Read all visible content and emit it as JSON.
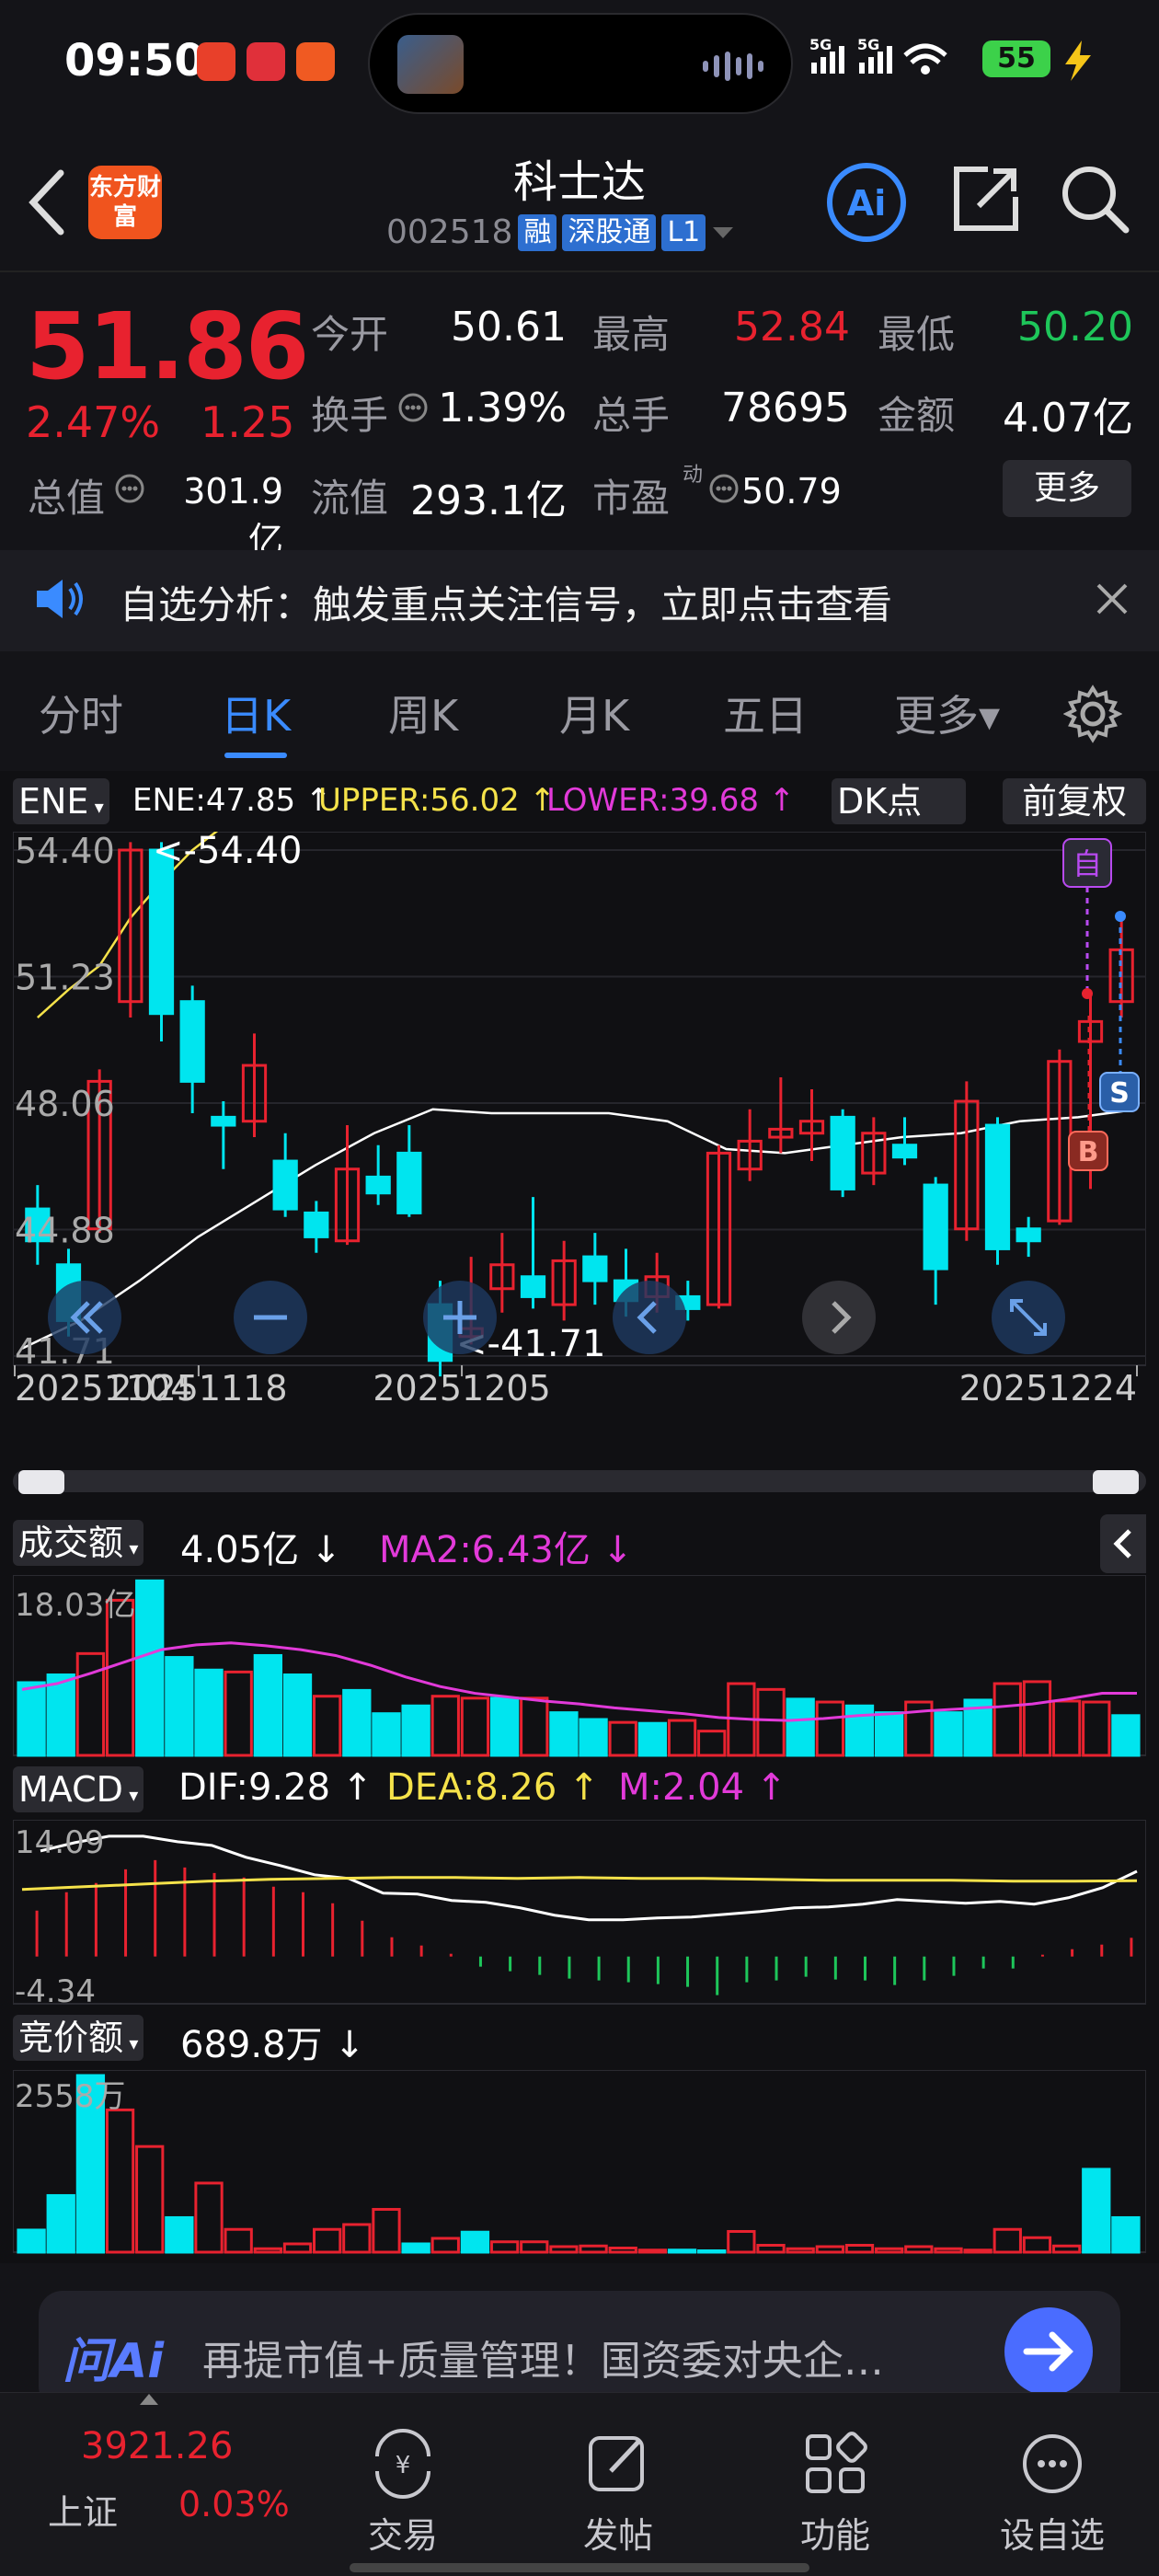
{
  "status_bar": {
    "time": "09:50",
    "battery": "55",
    "network": "5G 5G"
  },
  "header": {
    "logo_text": "东方财富",
    "stock_name": "科士达",
    "stock_code": "002518",
    "tags": [
      "融",
      "深股通",
      "L1"
    ]
  },
  "quote": {
    "price": "51.86",
    "change_pct": "2.47%",
    "change_amt": "1.25",
    "open_label": "今开",
    "open": "50.61",
    "high_label": "最高",
    "high": "52.84",
    "low_label": "最低",
    "low": "50.20",
    "turnover_label": "换手",
    "turnover": "1.39%",
    "volume_label": "总手",
    "volume": "78695",
    "amount_label": "金额",
    "amount": "4.07亿",
    "mktcap_label": "总值",
    "mktcap": "301.9亿",
    "float_label": "流值",
    "float": "293.1亿",
    "pe_label": "市盈",
    "pe_sup": "动",
    "pe": "50.79",
    "more": "更多"
  },
  "notice": {
    "text": "自选分析：触发重点关注信号，立即点击查看"
  },
  "tabs": [
    "分时",
    "日K",
    "周K",
    "月K",
    "五日",
    "更多▾"
  ],
  "kline": {
    "indicator": "ENE",
    "ene": "ENE:47.85 ↑",
    "upper": "UPPER:56.02 ↑",
    "lower": "LOWER:39.68 ↑",
    "dk_button": "DK点",
    "adjust_button": "前复权",
    "y_labels": [
      "54.40",
      "51.23",
      "48.06",
      "44.88",
      "41.71"
    ],
    "max_marker": "<-54.40",
    "min_marker": "<-41.71",
    "x_labels": [
      "20251104",
      "20251118",
      "20251205",
      "20251224"
    ],
    "mark_self": "自",
    "mark_s": "S",
    "mark_b": "B"
  },
  "volume_panel": {
    "indicator": "成交额",
    "value": "4.05亿 ↓",
    "ma2": "MA2:6.43亿 ↓",
    "y_max": "18.03亿"
  },
  "macd_panel": {
    "indicator": "MACD",
    "dif": "DIF:9.28 ↑",
    "dea": "DEA:8.26 ↑",
    "m": "M:2.04 ↑",
    "y_max": "14.09",
    "y_min": "-4.34"
  },
  "auction_panel": {
    "indicator": "竞价额",
    "value": "689.8万 ↓",
    "y_max": "2558万"
  },
  "ai_bar": {
    "logo": "问Ai",
    "text": "再提市值+质量管理！国资委对央企…"
  },
  "index": {
    "value": "3921.26",
    "name": "上证",
    "pct": "0.03%"
  },
  "nav": [
    "交易",
    "发帖",
    "功能",
    "设自选"
  ],
  "colors": {
    "up": "#e8222f",
    "down": "#1ec65a",
    "cyan": "#00e5ef",
    "accent": "#3a8bff",
    "yellow": "#f5e24a",
    "magenta": "#e23ad9"
  },
  "chart_data": [
    {
      "type": "candlestick",
      "title": "日K",
      "ylim": [
        41.71,
        54.4
      ],
      "candles": [
        {
          "o": 45.4,
          "c": 44.6,
          "h": 46.0,
          "l": 44.0
        },
        {
          "o": 44.0,
          "c": 42.6,
          "h": 44.4,
          "l": 42.2
        },
        {
          "o": 44.9,
          "c": 48.6,
          "h": 48.9,
          "l": 44.8
        },
        {
          "o": 50.6,
          "c": 54.4,
          "h": 54.6,
          "l": 50.2
        },
        {
          "o": 54.4,
          "c": 50.3,
          "h": 54.6,
          "l": 49.6
        },
        {
          "o": 50.6,
          "c": 48.6,
          "h": 51.0,
          "l": 47.8
        },
        {
          "o": 47.7,
          "c": 47.5,
          "h": 48.1,
          "l": 46.4
        },
        {
          "o": 47.6,
          "c": 49.0,
          "h": 49.8,
          "l": 47.2
        },
        {
          "o": 46.6,
          "c": 45.4,
          "h": 47.3,
          "l": 45.2
        },
        {
          "o": 45.3,
          "c": 44.7,
          "h": 45.6,
          "l": 44.3
        },
        {
          "o": 44.6,
          "c": 46.4,
          "h": 47.5,
          "l": 44.5
        },
        {
          "o": 46.2,
          "c": 45.8,
          "h": 47.0,
          "l": 45.5
        },
        {
          "o": 46.8,
          "c": 45.3,
          "h": 47.5,
          "l": 45.2
        },
        {
          "o": 43.0,
          "c": 41.6,
          "h": 43.6,
          "l": 41.2
        },
        {
          "o": 42.2,
          "c": 42.4,
          "h": 44.2,
          "l": 42.0
        },
        {
          "o": 43.4,
          "c": 44.0,
          "h": 44.8,
          "l": 42.8
        },
        {
          "o": 43.7,
          "c": 43.2,
          "h": 45.7,
          "l": 42.9
        },
        {
          "o": 43.0,
          "c": 44.1,
          "h": 44.6,
          "l": 42.6
        },
        {
          "o": 44.2,
          "c": 43.6,
          "h": 44.8,
          "l": 43.0
        },
        {
          "o": 43.6,
          "c": 43.1,
          "h": 44.4,
          "l": 42.7
        },
        {
          "o": 43.2,
          "c": 43.7,
          "h": 44.3,
          "l": 42.8
        },
        {
          "o": 43.2,
          "c": 42.9,
          "h": 43.6,
          "l": 42.6
        },
        {
          "o": 43.0,
          "c": 46.8,
          "h": 47.0,
          "l": 42.9
        },
        {
          "o": 46.4,
          "c": 47.1,
          "h": 47.9,
          "l": 46.1
        },
        {
          "o": 47.2,
          "c": 47.4,
          "h": 48.7,
          "l": 46.8
        },
        {
          "o": 47.3,
          "c": 47.6,
          "h": 48.4,
          "l": 46.6
        },
        {
          "o": 47.7,
          "c": 45.9,
          "h": 47.9,
          "l": 45.7
        },
        {
          "o": 46.3,
          "c": 47.3,
          "h": 47.7,
          "l": 46.0
        },
        {
          "o": 47.0,
          "c": 46.7,
          "h": 47.7,
          "l": 46.5
        },
        {
          "o": 46.0,
          "c": 43.9,
          "h": 46.2,
          "l": 43.0
        },
        {
          "o": 44.9,
          "c": 48.1,
          "h": 48.6,
          "l": 44.6
        },
        {
          "o": 47.5,
          "c": 44.4,
          "h": 47.7,
          "l": 44.0
        },
        {
          "o": 44.9,
          "c": 44.6,
          "h": 45.2,
          "l": 44.2
        },
        {
          "o": 45.1,
          "c": 49.1,
          "h": 49.4,
          "l": 45.0
        },
        {
          "o": 49.6,
          "c": 50.1,
          "h": 50.8,
          "l": 45.9
        },
        {
          "o": 50.6,
          "c": 51.9,
          "h": 52.8,
          "l": 50.2
        }
      ],
      "ene_upper": [
        50.2,
        50.9,
        51.5,
        52.7,
        53.6,
        54.4,
        55.0,
        55.7,
        56.0,
        56.0
      ],
      "ene_mid": [
        41.9,
        42.6,
        43.6,
        44.7,
        45.6,
        46.5,
        47.3,
        47.9,
        47.8,
        47.8,
        47.8,
        47.6,
        46.9,
        46.8,
        47.0,
        47.2,
        47.3,
        47.6,
        47.7,
        47.9
      ]
    },
    {
      "type": "bar",
      "title": "成交额",
      "y_max_label": "18.03亿",
      "values": [
        7.5,
        8.3,
        10.5,
        16.0,
        18.0,
        10.1,
        8.8,
        8.6,
        10.3,
        8.3,
        6.1,
        6.7,
        4.3,
        5.1,
        6.1,
        5.9,
        5.9,
        5.9,
        4.4,
        3.7,
        3.4,
        3.3,
        3.6,
        2.5,
        7.4,
        6.8,
        5.8,
        5.5,
        5.1,
        4.4,
        5.5,
        4.4,
        5.7,
        7.4,
        7.6,
        5.6,
        5.5,
        4.1
      ],
      "up": [
        false,
        false,
        true,
        true,
        false,
        false,
        false,
        true,
        false,
        false,
        true,
        false,
        false,
        false,
        true,
        true,
        false,
        true,
        false,
        false,
        true,
        false,
        true,
        true,
        true,
        true,
        false,
        true,
        false,
        false,
        true,
        false,
        false,
        true,
        true,
        true,
        true,
        false
      ],
      "ma2": [
        6.8,
        7.4,
        8.5,
        9.7,
        10.9,
        11.4,
        11.6,
        11.3,
        10.9,
        10.3,
        9.3,
        8.1,
        7.1,
        6.4,
        6.0,
        5.6,
        5.3,
        4.9,
        4.6,
        4.3,
        3.9,
        3.7,
        3.6,
        3.8,
        4.1,
        4.3,
        4.6,
        4.8,
        5.0,
        5.3,
        5.8,
        6.4,
        6.4
      ]
    },
    {
      "type": "bar",
      "title": "MACD",
      "ylim": [
        -4.34,
        14.09
      ],
      "values": [
        5.0,
        7.0,
        8.0,
        9.5,
        10.5,
        9.7,
        9.1,
        8.6,
        7.6,
        7.0,
        5.8,
        3.9,
        2.1,
        1.2,
        0.3,
        -1.1,
        -1.6,
        -2.0,
        -2.4,
        -2.6,
        -2.8,
        -3.0,
        -3.3,
        -4.2,
        -2.8,
        -2.6,
        -2.2,
        -2.5,
        -2.6,
        -3.1,
        -2.6,
        -2.1,
        -1.3,
        -1.3,
        0.2,
        0.8,
        1.3,
        2.04
      ],
      "dif_series": [
        11.5,
        12.4,
        13.1,
        13.1,
        12.5,
        12.1,
        10.8,
        9.9,
        8.9,
        8.5,
        6.9,
        6.8,
        6.1,
        5.9,
        5.3,
        4.5,
        4.0,
        4.0,
        4.2,
        4.3,
        4.6,
        4.9,
        5.3,
        5.4,
        5.7,
        6.2,
        6.0,
        5.8,
        6.0,
        5.7,
        6.4,
        7.5,
        9.28
      ],
      "dea_series": [
        7.3,
        7.6,
        7.9,
        8.2,
        8.4,
        8.5,
        8.6,
        8.6,
        8.5,
        8.6,
        8.5,
        8.5,
        8.4,
        8.3,
        8.3,
        8.3,
        8.2,
        8.2,
        8.26
      ]
    },
    {
      "type": "bar",
      "title": "竞价额",
      "y_max_label": "2558万",
      "values": [
        320,
        820,
        2558,
        2060,
        1530,
        500,
        1000,
        330,
        50,
        120,
        330,
        400,
        620,
        120,
        200,
        290,
        150,
        150,
        80,
        90,
        60,
        30,
        30,
        20,
        300,
        100,
        50,
        80,
        100,
        50,
        80,
        50,
        30,
        330,
        210,
        90,
        1200,
        500
      ],
      "up": [
        false,
        false,
        false,
        true,
        true,
        false,
        true,
        true,
        true,
        true,
        true,
        true,
        true,
        false,
        true,
        false,
        true,
        true,
        true,
        true,
        true,
        true,
        false,
        false,
        true,
        true,
        true,
        true,
        true,
        true,
        true,
        true,
        true,
        true,
        true,
        true,
        false,
        false
      ]
    }
  ]
}
